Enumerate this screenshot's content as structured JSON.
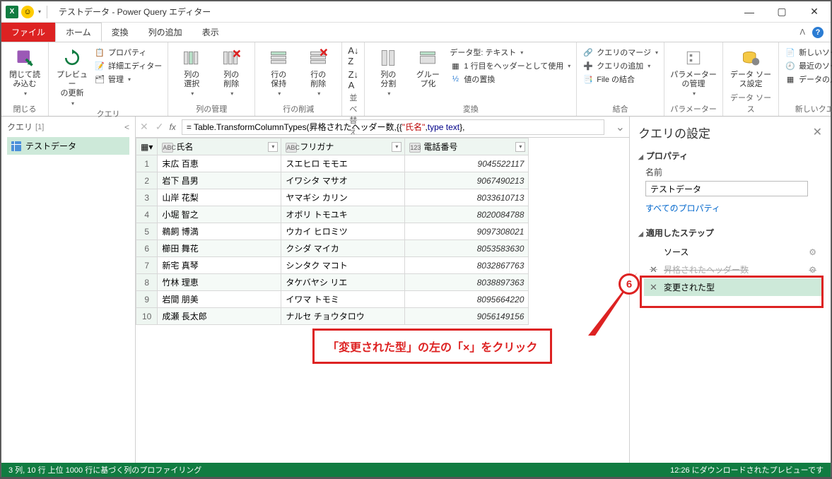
{
  "title": "テストデータ - Power Query エディター",
  "tabs": {
    "file": "ファイル",
    "home": "ホーム",
    "transform": "変換",
    "addcol": "列の追加",
    "view": "表示"
  },
  "ribbon": {
    "close": {
      "btn": "閉じて読\nみ込む",
      "group": "閉じる"
    },
    "query": {
      "refresh": "プレビュー\nの更新",
      "properties": "プロパティ",
      "adv": "詳細エディター",
      "manage": "管理",
      "group": "クエリ"
    },
    "cols": {
      "choose": "列の\n選択",
      "remove": "列の\n削除",
      "group": "列の管理"
    },
    "rows": {
      "keep": "行の\n保持",
      "remove": "行の\n削除",
      "group": "行の削減"
    },
    "sort": {
      "group": "並べ替え"
    },
    "split": {
      "split": "列の\n分割",
      "groupby": "グルー\nプ化",
      "datatype": "データ型: テキスト",
      "firstrow": "1 行目をヘッダーとして使用",
      "replace": "値の置換",
      "group": "変換"
    },
    "combine": {
      "merge": "クエリのマージ",
      "append": "クエリの追加",
      "combinefiles": "File の結合",
      "group": "結合"
    },
    "params": {
      "btn": "パラメーター\nの管理",
      "group": "パラメーター"
    },
    "ds": {
      "btn": "データ ソー\nス設定",
      "group": "データ ソース"
    },
    "new": {
      "newsrc": "新しいソース",
      "recent": "最近のソース",
      "enter": "データの入力",
      "group": "新しいクエリ"
    }
  },
  "queries": {
    "header": "クエリ",
    "count": "[1]",
    "item": "テストデータ"
  },
  "formula": {
    "prefix": "= Table.TransformColumnTypes(昇格されたヘッダー数,{{",
    "col": "\"氏名\"",
    "sep": ", ",
    "type": "type text",
    "suffix": "},"
  },
  "columns": [
    "氏名",
    "フリガナ",
    "電話番号"
  ],
  "rows": [
    {
      "n": 1,
      "a": "末広 百恵",
      "b": "スエヒロ モモエ",
      "c": "9045522117"
    },
    {
      "n": 2,
      "a": "岩下 昌男",
      "b": "イワシタ マサオ",
      "c": "9067490213"
    },
    {
      "n": 3,
      "a": "山岸 花梨",
      "b": "ヤマギシ カリン",
      "c": "8033610713"
    },
    {
      "n": 4,
      "a": "小堀 智之",
      "b": "オボリ トモユキ",
      "c": "8020084788"
    },
    {
      "n": 5,
      "a": "鵜飼 博満",
      "b": "ウカイ ヒロミツ",
      "c": "9097308021"
    },
    {
      "n": 6,
      "a": "櫛田 舞花",
      "b": "クシダ マイカ",
      "c": "8053583630"
    },
    {
      "n": 7,
      "a": "新宅 真琴",
      "b": "シンタク マコト",
      "c": "8032867763"
    },
    {
      "n": 8,
      "a": "竹林 理恵",
      "b": "タケバヤシ リエ",
      "c": "8038897363"
    },
    {
      "n": 9,
      "a": "岩間 朋美",
      "b": "イワマ トモミ",
      "c": "8095664220"
    },
    {
      "n": 10,
      "a": "成瀬 長太郎",
      "b": "ナルセ チョウタロウ",
      "c": "9056149156"
    }
  ],
  "settings": {
    "title": "クエリの設定",
    "props": "プロパティ",
    "name_label": "名前",
    "name_value": "テストデータ",
    "allprops": "すべてのプロパティ",
    "steps_hdr": "適用したステップ",
    "steps": {
      "source": "ソース",
      "promoted": "昇格されたヘッダー数",
      "changed": "変更された型"
    }
  },
  "status": {
    "left": "3 列, 10 行    上位 1000 行に基づく列のプロファイリング",
    "right": "12:26 にダウンロードされたプレビューです"
  },
  "annotation": {
    "num": "6",
    "callout": "「変更された型」の左の「×」をクリック"
  }
}
